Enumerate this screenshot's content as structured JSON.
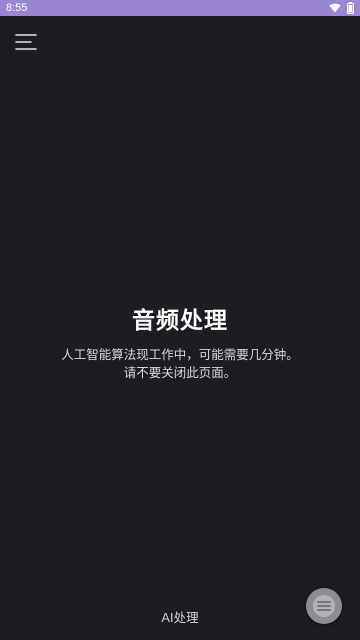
{
  "status_bar": {
    "time": "8:55",
    "background": "#9b86d4"
  },
  "menu": {
    "icon": "hamburger-menu-icon"
  },
  "main": {
    "title": "音频处理",
    "description_line1": "人工智能算法现工作中，可能需要几分钟。",
    "description_line2": "请不要关闭此页面。"
  },
  "footer": {
    "label": "AI处理"
  },
  "fab": {
    "icon": "menu-lines-icon"
  },
  "colors": {
    "background": "#1c1c22",
    "title": "#ffffff",
    "text": "#d8d8dc"
  }
}
